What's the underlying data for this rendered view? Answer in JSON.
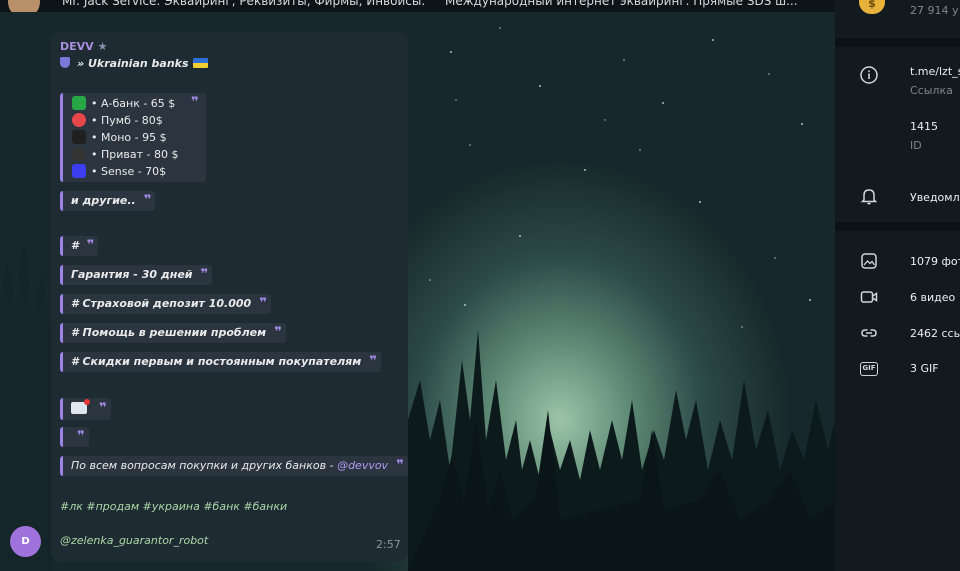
{
  "top_bar": {
    "ticker_left": "Mr. Jack Service: Эквайринг, Реквизиты, Фирмы, Инвойсы.",
    "ticker_right": "Международный интернет эквайринг. Прямые SDS ш..."
  },
  "message": {
    "sender": "DEVV",
    "subtitle": "» Ukrainian banks",
    "banks": [
      {
        "label": "• А-банк - 65 $",
        "icon_color": "#28a745",
        "icon": "android-icon"
      },
      {
        "label": "• Пумб - 80$",
        "icon_color": "#e8474a",
        "icon": "pumb-icon"
      },
      {
        "label": "• Моно - 95 $",
        "icon_color": "#202020",
        "icon": "mono-icon"
      },
      {
        "label": "• Приват - 80 $",
        "icon_color": "#333333",
        "icon": "privat-icon"
      },
      {
        "label": "• Sense - 70$",
        "icon_color": "#3d3df0",
        "icon": "sense-icon"
      }
    ],
    "others": "и другие..",
    "hash_only": "#",
    "guarantee": "Гарантия - 30 дней",
    "deposit": "# Страховой депозит 10.000",
    "help": "# Помощь в решении проблем",
    "discounts": "# Скидки первым и постоянным покупателям",
    "contact_prefix": "По всем вопросам покупки и других банков - ",
    "contact_mention": "@devvov",
    "hashtags": "#лк #продам #украина #банк #банки",
    "bot": "@zelenka_guarantor_robot",
    "time": "2:57",
    "avatar_letter": "D"
  },
  "info_panel": {
    "members": "27 914 у",
    "link": "t.me/lzt_s",
    "link_label": "Ссылка",
    "id_value": "1415",
    "id_label": "ID",
    "notifications": "Уведомл",
    "photos": "1079 фот",
    "videos": "6 видео",
    "links": "2462 ссы",
    "gifs": "3 GIF",
    "gif_icon_text": "GIF"
  },
  "colors": {
    "accent": "#9a82e6",
    "hashtag": "#a9d8a6",
    "bubble": "#1f2b32"
  }
}
